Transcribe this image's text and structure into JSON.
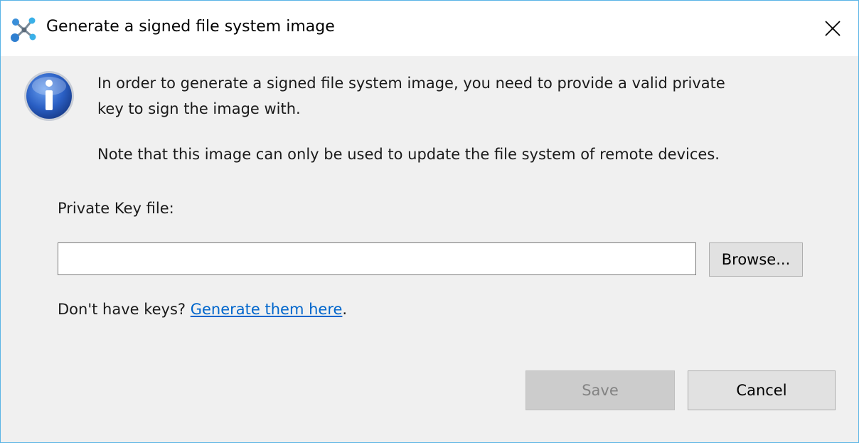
{
  "window": {
    "title": "Generate a signed file system image",
    "app_icon": "molecule-network-icon",
    "close_icon": "close-icon"
  },
  "content": {
    "info_icon": "info-icon",
    "message_line1": "In order to generate a signed file system image, you need to provide a valid private",
    "message_line2": "key to sign the image with.",
    "note": "Note that this image can only be used to update the file system of remote devices.",
    "private_key_label": "Private Key file:",
    "private_key_value": "",
    "browse_label": "Browse...",
    "keys_prompt": "Don't have keys? ",
    "keys_link": "Generate them here",
    "keys_suffix": "."
  },
  "footer": {
    "save_label": "Save",
    "save_enabled": false,
    "cancel_label": "Cancel"
  },
  "colors": {
    "window_border": "#5ab4e6",
    "dialog_background": "#f0f0f0",
    "link": "#0066cc",
    "info_icon_blue": "#2a5fc4"
  }
}
